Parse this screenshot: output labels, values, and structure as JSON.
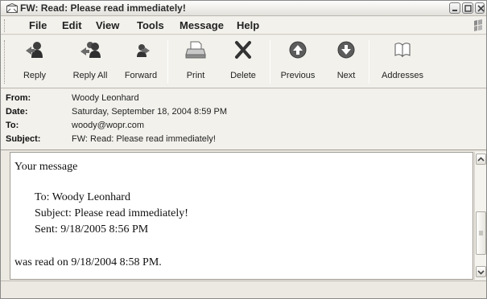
{
  "window": {
    "title": "FW: Read: Please read immediately!"
  },
  "menu": {
    "items": [
      "File",
      "Edit",
      "View",
      "Tools",
      "Message",
      "Help"
    ]
  },
  "toolbar": {
    "buttons": [
      {
        "label": "Reply",
        "icon": "reply-icon"
      },
      {
        "label": "Reply All",
        "icon": "reply-all-icon"
      },
      {
        "label": "Forward",
        "icon": "forward-icon"
      },
      {
        "label": "Print",
        "icon": "print-icon"
      },
      {
        "label": "Delete",
        "icon": "delete-icon"
      },
      {
        "label": "Previous",
        "icon": "previous-icon"
      },
      {
        "label": "Next",
        "icon": "next-icon"
      },
      {
        "label": "Addresses",
        "icon": "addresses-icon"
      }
    ]
  },
  "headers": {
    "from": {
      "label": "From:",
      "value": "Woody Leonhard"
    },
    "date": {
      "label": "Date:",
      "value": "Saturday, September 18, 2004 8:59 PM"
    },
    "to": {
      "label": "To:",
      "value": "woody@wopr.com"
    },
    "subject": {
      "label": "Subject:",
      "value": "FW: Read: Please read immediately!"
    }
  },
  "message": {
    "intro": "Your message",
    "to_line": "To:  Woody Leonhard",
    "subject_line": "Subject:  Please read immediately!",
    "sent_line": "Sent:  9/18/2005 8:56 PM",
    "read_line": "was read on 9/18/2004 8:58 PM."
  }
}
